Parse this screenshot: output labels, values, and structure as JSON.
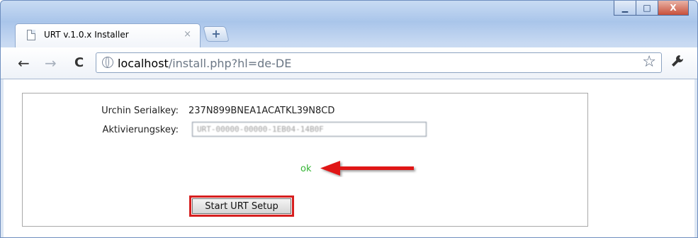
{
  "browser": {
    "tab": {
      "title": "URT v.1.0.x Installer",
      "close_glyph": "×"
    },
    "new_tab_glyph": "+",
    "address": {
      "host": "localhost",
      "path": "/install.php?hl=de-DE"
    },
    "window_controls": {
      "minimize": "▁",
      "maximize": "□",
      "close": "X"
    },
    "nav": {
      "back": "←",
      "forward": "→",
      "reload": "C",
      "star": "☆",
      "wrench": "🔧"
    }
  },
  "form": {
    "serial_label": "Urchin Serialkey:",
    "serial_value": "237N899BNEA1ACATKL39N8CD",
    "activation_label": "Aktivierungskey:",
    "activation_value": "URT-00000-00000-1EB04-14B0F",
    "status": "ok",
    "start_button": "Start URT Setup"
  },
  "colors": {
    "status_ok": "#33b533",
    "annotation_red": "#d61f1f"
  }
}
